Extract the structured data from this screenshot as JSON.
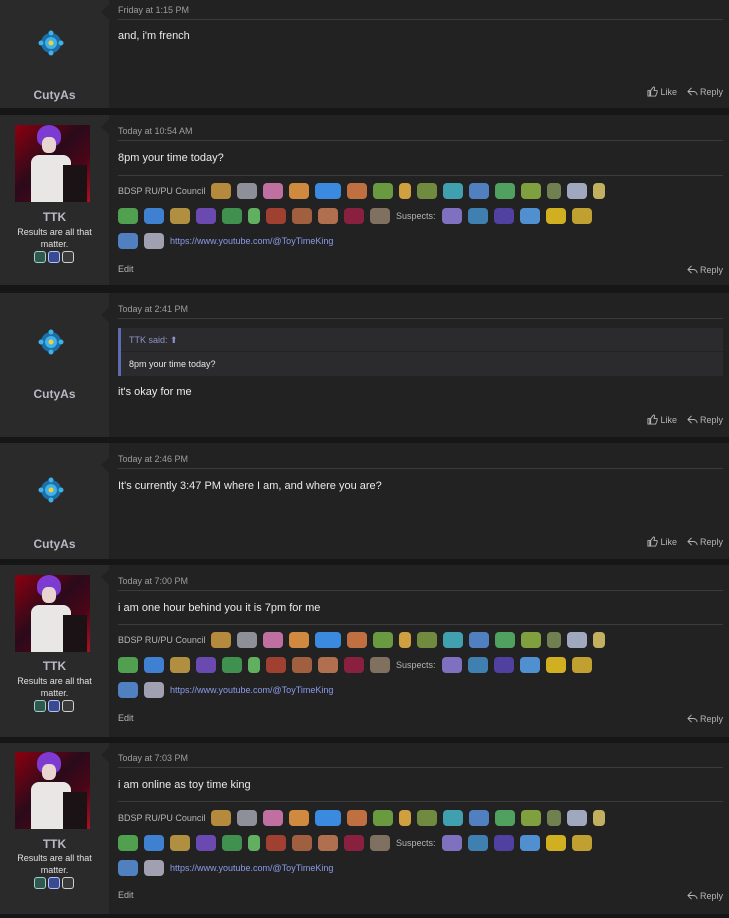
{
  "colors": {
    "page_bg": "#161616",
    "post_bg": "#222223",
    "user_bg": "#2a2a2b",
    "link": "#8a9be8",
    "quote_bar": "#5f6bb0",
    "username": "#b9b9c6"
  },
  "actions": {
    "like": "Like",
    "reply": "Reply",
    "edit": "Edit"
  },
  "signature": {
    "council_label": "BDSP RU/PU Council",
    "suspects_label": "Suspects:",
    "link": "https://www.youtube.com/@ToyTimeKing",
    "sprite_icons": [
      "pokemon-sprite-icon"
    ]
  },
  "users": {
    "cutyas": {
      "name": "CutyAs",
      "avatar_icon": "gem-avatar-icon"
    },
    "ttk": {
      "name": "TTK",
      "title": "Results are all that matter.",
      "badges": [
        "badge-icon",
        "badge-icon",
        "badge-icon"
      ]
    }
  },
  "posts": [
    {
      "author": "CutyAs",
      "time": "Friday at 1:15 PM",
      "message": "and, i'm french"
    },
    {
      "author": "TTK",
      "time": "Today at 10:54 AM",
      "message": "8pm your time today?"
    },
    {
      "author": "CutyAs",
      "time": "Today at 2:41 PM",
      "quote_author": "TTK said:",
      "quote_text": "8pm your time today?",
      "message": "it's okay for me"
    },
    {
      "author": "CutyAs",
      "time": "Today at 2:46 PM",
      "message": "It's currently 3:47 PM where I am, and where you are?"
    },
    {
      "author": "TTK",
      "time": "Today at 7:00 PM",
      "message": "i am one hour behind you it is 7pm for me"
    },
    {
      "author": "TTK",
      "time": "Today at 7:03 PM",
      "message": "i am online as toy time king"
    }
  ]
}
